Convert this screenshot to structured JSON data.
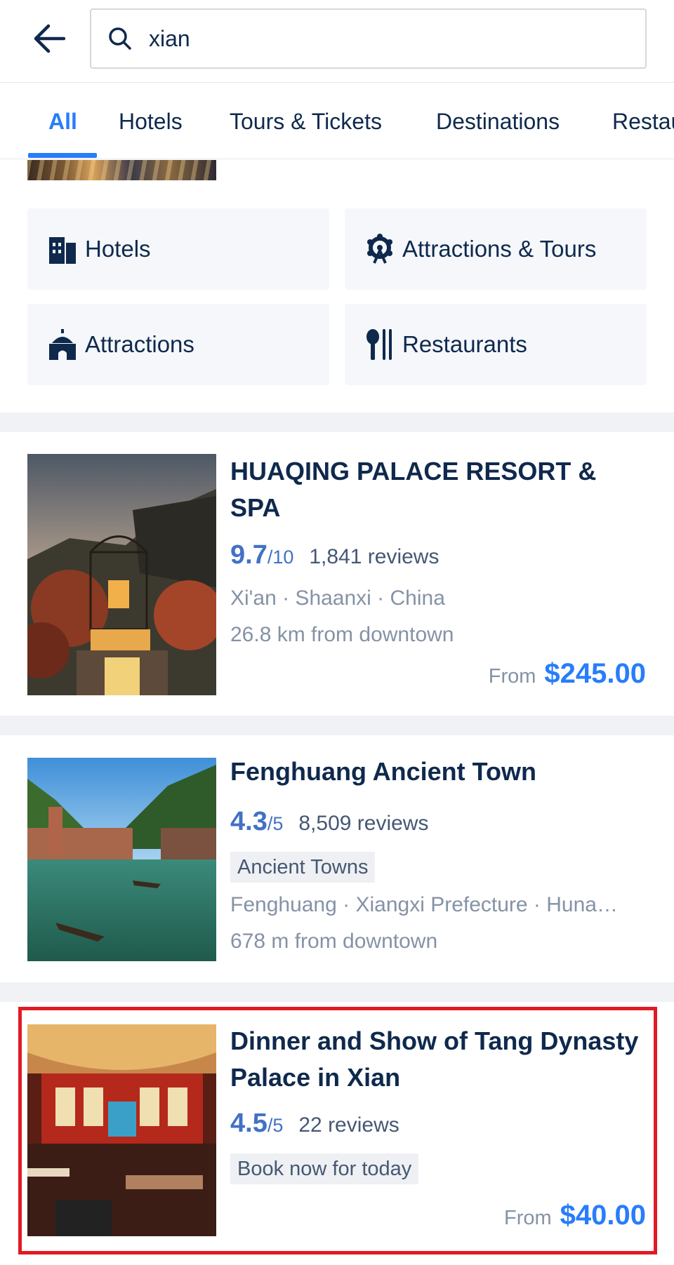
{
  "search": {
    "value": "xian"
  },
  "tabs": [
    {
      "label": "All",
      "active": true
    },
    {
      "label": "Hotels"
    },
    {
      "label": "Tours & Tickets"
    },
    {
      "label": "Destinations"
    },
    {
      "label": "Restaurants"
    }
  ],
  "categories": [
    {
      "label": "Hotels",
      "icon": "building-icon"
    },
    {
      "label": "Attractions & Tours",
      "icon": "ferris-wheel-icon"
    },
    {
      "label": "Attractions",
      "icon": "landmark-icon"
    },
    {
      "label": "Restaurants",
      "icon": "fork-knife-icon"
    }
  ],
  "results": [
    {
      "title": "HUAQING PALACE RESORT & SPA",
      "score": "9.7",
      "scale": "/10",
      "reviews": "1,841 reviews",
      "location": "Xi'an · Shaanxi · China",
      "distance": "26.8 km from downtown",
      "from_label": "From",
      "price": "$245.00"
    },
    {
      "title": "Fenghuang Ancient Town",
      "score": "4.3",
      "scale": "/5",
      "reviews": "8,509 reviews",
      "tag": "Ancient Towns",
      "location": "Fenghuang · Xiangxi Prefecture · Huna…",
      "distance": "678 m from downtown"
    },
    {
      "title": "Dinner and Show of Tang Dynasty Palace in Xian",
      "score": "4.5",
      "scale": "/5",
      "reviews": "22 reviews",
      "tag": "Book now for today",
      "from_label": "From",
      "price": "$40.00"
    }
  ],
  "colors": {
    "accent": "#287dfa",
    "rating": "#4271c5",
    "title": "#0f294d",
    "highlight": "#e01b24"
  }
}
